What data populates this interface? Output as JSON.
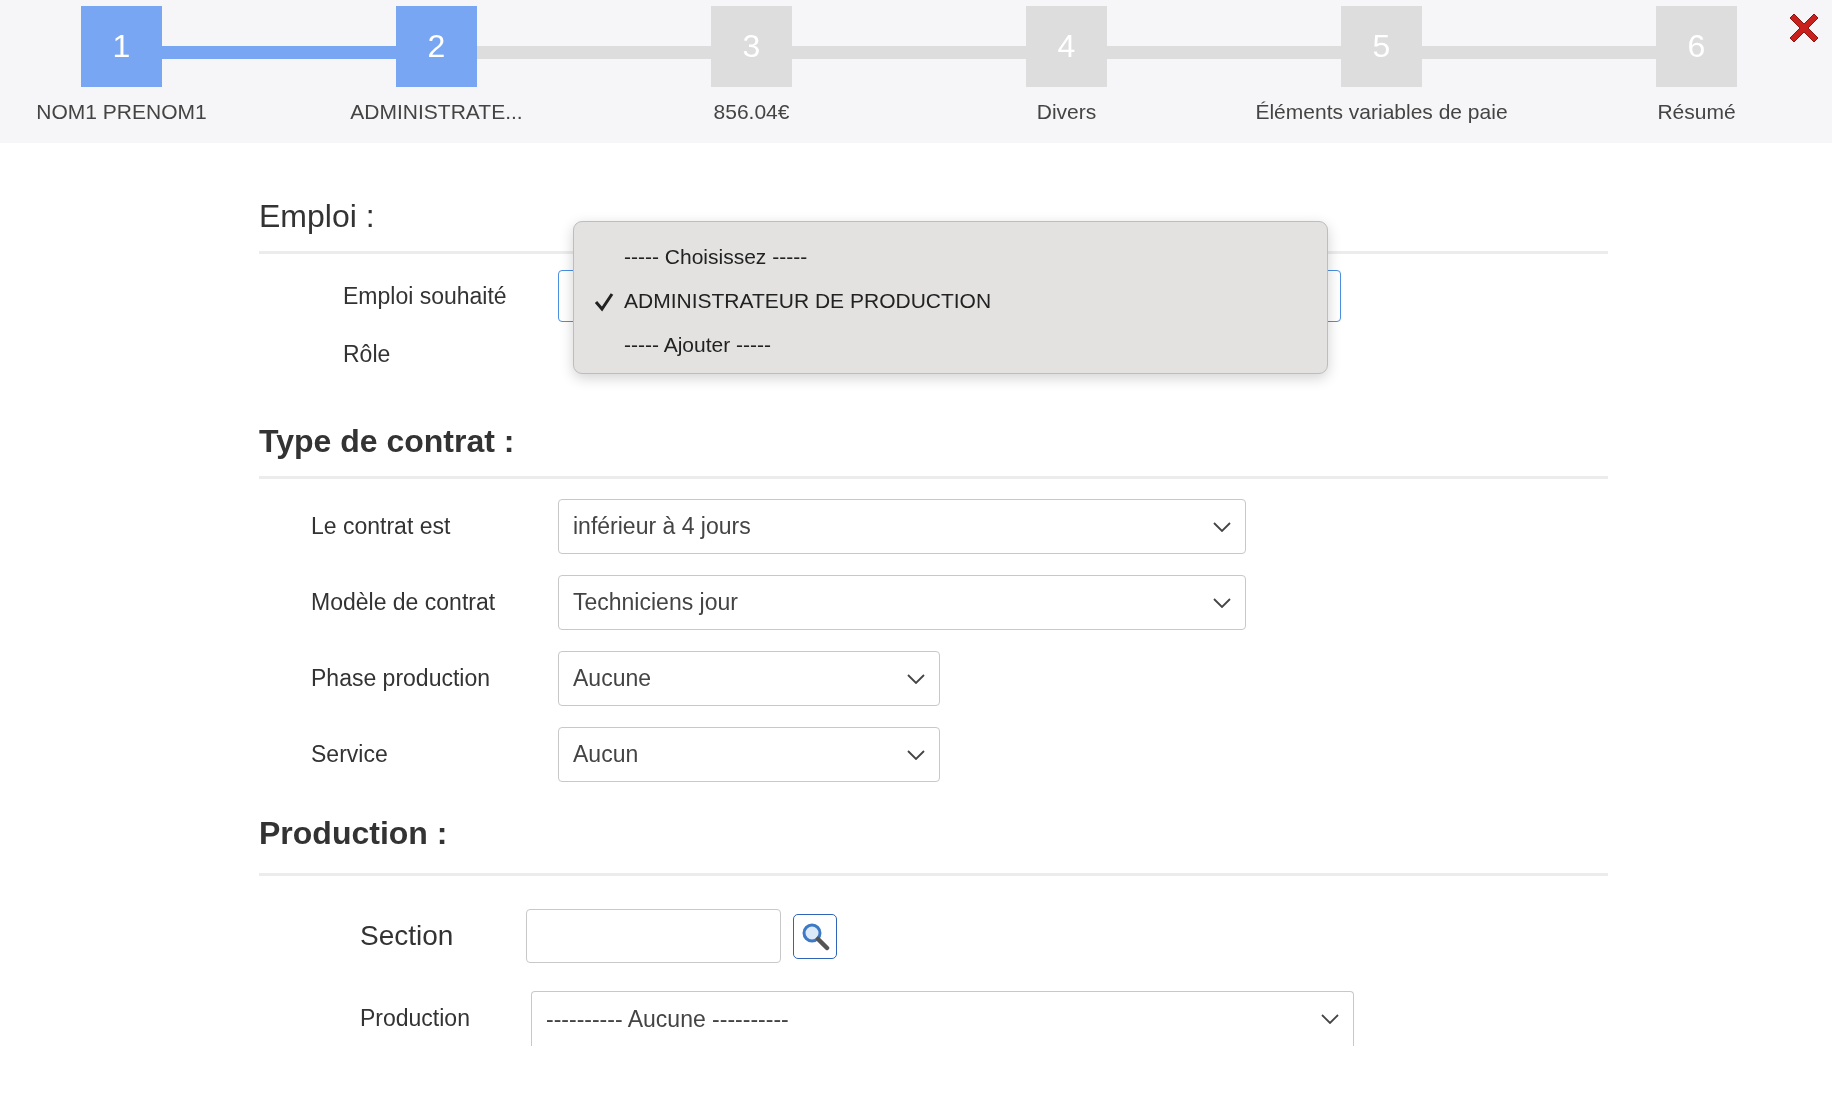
{
  "steps": [
    {
      "number": "1",
      "label": "NOM1 PRENOM1",
      "reached": true
    },
    {
      "number": "2",
      "label": "ADMINISTRATE...",
      "reached": true
    },
    {
      "number": "3",
      "label": "856.04€",
      "reached": false
    },
    {
      "number": "4",
      "label": "Divers",
      "reached": false
    },
    {
      "number": "5",
      "label": "Éléments variables de paie",
      "reached": false
    },
    {
      "number": "6",
      "label": "Résumé",
      "reached": false
    }
  ],
  "emploi": {
    "heading": "Emploi :",
    "fields": [
      {
        "label": "Emploi souhaité"
      },
      {
        "label": "Rôle"
      }
    ],
    "dropdown": {
      "options": [
        {
          "label": "----- Choisissez -----",
          "selected": false
        },
        {
          "label": "ADMINISTRATEUR DE PRODUCTION",
          "selected": true
        },
        {
          "label": "----- Ajouter -----",
          "selected": false
        }
      ]
    }
  },
  "contrat": {
    "heading": "Type de contrat :",
    "fields": [
      {
        "label": "Le contrat est",
        "value": "inférieur à 4 jours"
      },
      {
        "label": "Modèle de contrat",
        "value": "Techniciens jour"
      },
      {
        "label": "Phase production",
        "value": "Aucune"
      },
      {
        "label": "Service",
        "value": "Aucun"
      }
    ]
  },
  "production": {
    "heading": "Production :",
    "section": {
      "label": "Section"
    },
    "production": {
      "label": "Production",
      "value": "---------- Aucune ----------"
    }
  }
}
